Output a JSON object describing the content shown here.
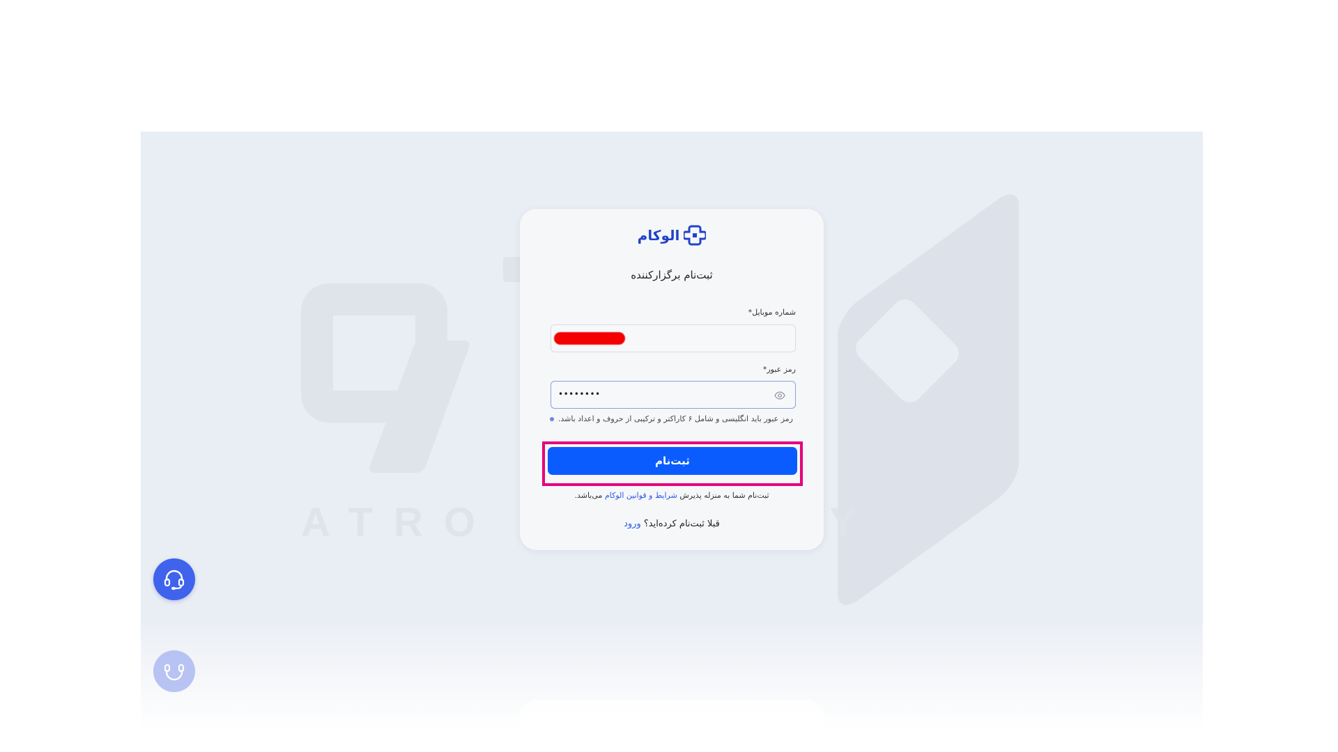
{
  "logo": {
    "text": "الوکام",
    "color": "#2142c9"
  },
  "form": {
    "title": "ثبت‌نام برگزارکننده",
    "phone": {
      "label": "شماره موبایل*",
      "value_redacted": true
    },
    "password": {
      "label": "رمز عبور*",
      "value": "••••••••",
      "toggle_icon": "eye-icon"
    },
    "hint": "رمز عبور باید انگلیسی و شامل ۶ کاراکتر و ترکیبی از حروف و اعداد باشد.",
    "submit_label": "ثبت‌نام",
    "terms": {
      "prefix": "ثبت‌نام شما به منزله پذیرش",
      "link": "شرایط و قوانین الوکام",
      "suffix": "می‌باشد."
    },
    "already": {
      "text": "قبلا ثبت‌نام کرده‌اید؟",
      "link": "ورود"
    }
  },
  "watermark": {
    "text": "ATRO ACADEMY"
  },
  "support": {
    "icon": "headset-icon"
  },
  "colors": {
    "accent": "#0b5cff",
    "highlight": "#e6007e",
    "background": "#e9edf4",
    "card": "#f6f7f9"
  }
}
